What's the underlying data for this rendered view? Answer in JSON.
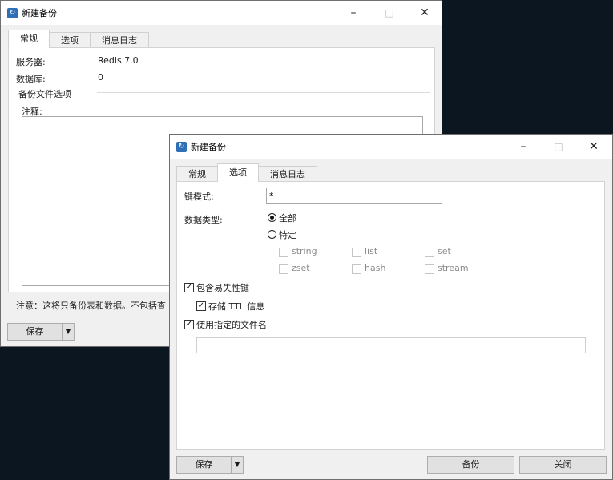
{
  "back_window": {
    "title": "新建备份",
    "tabs": [
      "常规",
      "选项",
      "消息日志"
    ],
    "server_label": "服务器:",
    "server_value": "Redis 7.0",
    "database_label": "数据库:",
    "database_value": "0",
    "group_title": "备份文件选项",
    "comment_label": "注释:",
    "note": "注意：这将只备份表和数据。不包括查",
    "save_label": "保存"
  },
  "front_window": {
    "title": "新建备份",
    "tabs": [
      "常规",
      "选项",
      "消息日志"
    ],
    "key_pattern_label": "键模式:",
    "key_pattern_value": "*",
    "data_type_label": "数据类型:",
    "all_label": "全部",
    "specific_label": "特定",
    "types": [
      "string",
      "list",
      "set",
      "zset",
      "hash",
      "stream"
    ],
    "include_volatile": "包含易失性键",
    "store_ttl": "存储 TTL 信息",
    "use_filename": "使用指定的文件名",
    "filename_value": "",
    "save_label": "保存",
    "backup_label": "备份",
    "close_label": "关闭"
  },
  "window_controls": {
    "minimize": "–",
    "maximize": "□",
    "close": "✕"
  }
}
